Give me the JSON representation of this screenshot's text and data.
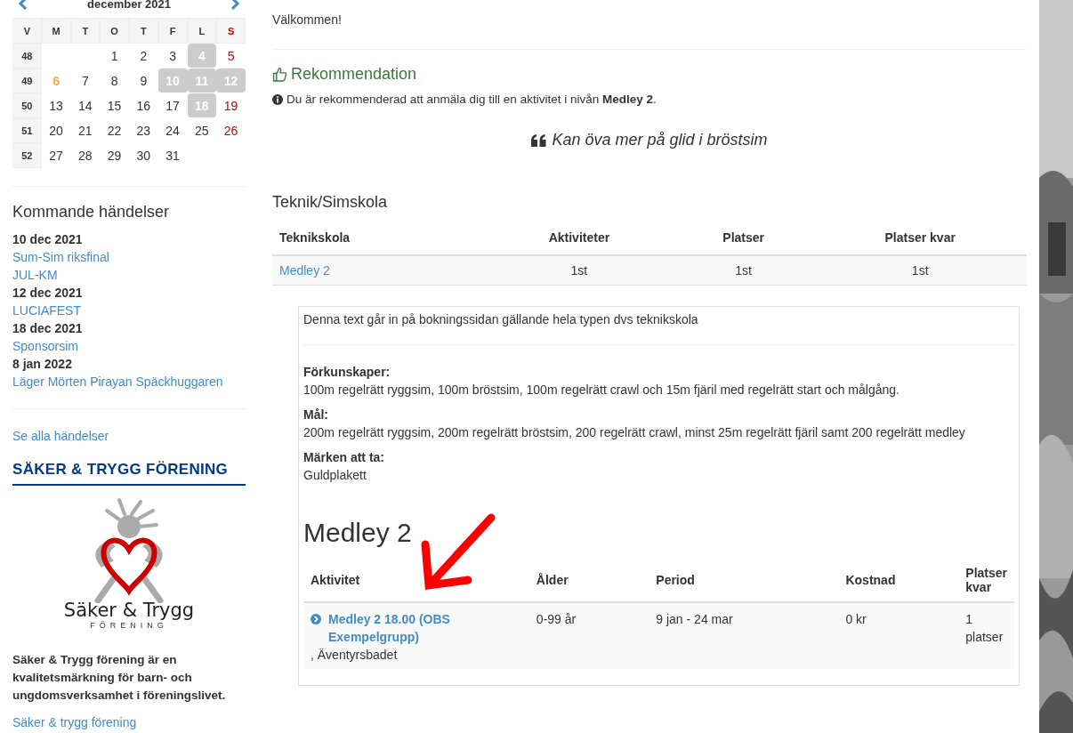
{
  "calendar": {
    "month": "december 2021",
    "headers": [
      {
        "label": "V",
        "kind": "week"
      },
      {
        "label": "M",
        "kind": "day"
      },
      {
        "label": "T",
        "kind": "day"
      },
      {
        "label": "O",
        "kind": "day"
      },
      {
        "label": "T",
        "kind": "day"
      },
      {
        "label": "F",
        "kind": "day"
      },
      {
        "label": "L",
        "kind": "day"
      },
      {
        "label": "S",
        "kind": "sunday"
      }
    ],
    "weeks": [
      {
        "week": "48",
        "days": [
          {
            "kind": "empty"
          },
          {
            "kind": "empty"
          },
          {
            "label": "1",
            "kind": "normal"
          },
          {
            "label": "2",
            "kind": "normal"
          },
          {
            "label": "3",
            "kind": "normal"
          },
          {
            "label": "4",
            "kind": "event"
          },
          {
            "label": "5",
            "kind": "sunday"
          }
        ]
      },
      {
        "week": "49",
        "days": [
          {
            "label": "6",
            "kind": "today"
          },
          {
            "label": "7",
            "kind": "normal"
          },
          {
            "label": "8",
            "kind": "normal"
          },
          {
            "label": "9",
            "kind": "normal"
          },
          {
            "label": "10",
            "kind": "event"
          },
          {
            "label": "11",
            "kind": "event"
          },
          {
            "label": "12",
            "kind": "event"
          }
        ]
      },
      {
        "week": "50",
        "days": [
          {
            "label": "13",
            "kind": "normal"
          },
          {
            "label": "14",
            "kind": "normal"
          },
          {
            "label": "15",
            "kind": "normal"
          },
          {
            "label": "16",
            "kind": "normal"
          },
          {
            "label": "17",
            "kind": "normal"
          },
          {
            "label": "18",
            "kind": "event"
          },
          {
            "label": "19",
            "kind": "sunday"
          }
        ]
      },
      {
        "week": "51",
        "days": [
          {
            "label": "20",
            "kind": "normal"
          },
          {
            "label": "21",
            "kind": "normal"
          },
          {
            "label": "22",
            "kind": "normal"
          },
          {
            "label": "23",
            "kind": "normal"
          },
          {
            "label": "24",
            "kind": "normal"
          },
          {
            "label": "25",
            "kind": "normal"
          },
          {
            "label": "26",
            "kind": "sunday"
          }
        ]
      },
      {
        "week": "52",
        "days": [
          {
            "label": "27",
            "kind": "normal"
          },
          {
            "label": "28",
            "kind": "normal"
          },
          {
            "label": "29",
            "kind": "normal"
          },
          {
            "label": "30",
            "kind": "normal"
          },
          {
            "label": "31",
            "kind": "normal"
          },
          {
            "kind": "empty"
          },
          {
            "kind": "empty"
          }
        ]
      }
    ]
  },
  "upcoming": {
    "title": "Kommande händelser",
    "items": [
      {
        "kind": "date",
        "text": "10 dec 2021"
      },
      {
        "kind": "link",
        "text": "Sum-Sim riksfinal"
      },
      {
        "kind": "link",
        "text": "JUL-KM"
      },
      {
        "kind": "date",
        "text": "12 dec 2021"
      },
      {
        "kind": "link",
        "text": "LUCIAFEST"
      },
      {
        "kind": "date",
        "text": "18 dec 2021"
      },
      {
        "kind": "link",
        "text": "Sponsorsim"
      },
      {
        "kind": "date",
        "text": "8 jan 2022"
      },
      {
        "kind": "link",
        "text": "Läger Mörten Pirayan Späckhuggaren"
      }
    ],
    "see_all": "Se alla händelser"
  },
  "safe_club": {
    "title": "SÄKER & TRYGG FÖRENING",
    "logo_name": "Säker & Trygg",
    "logo_sub": "FÖRENING",
    "text": "Säker & Trygg förening är en kvalitetsmärkning för barn- och ungdomsverksamhet i föreningslivet.",
    "link": "Säker & trygg förening"
  },
  "welcome": "Välkommen!",
  "recommendation": {
    "title": "Rekommendation",
    "text": "Du är rekommenderad att anmäla dig till en aktivitet i nivån **Medley 2**.",
    "quote": "Kan öva mer på glid i bröstsim"
  },
  "school": {
    "title": "Teknik/Simskola",
    "columns": [
      "Teknikskola",
      "Aktiviteter",
      "Platser",
      "Platser kvar"
    ],
    "rows": [
      {
        "name": "Medley 2",
        "activities": "1st",
        "places": "1st",
        "left": "1st"
      }
    ]
  },
  "details": {
    "intro": "Denna text går in på bokningssidan gällande hela typen dvs teknikskola",
    "sections": [
      {
        "label": "Förkunskaper:",
        "text": "100m regelrätt ryggsim, 100m bröstsim, 100m regelrätt crawl och 15m fjäril med regelrätt start och målgång."
      },
      {
        "label": "Mål:",
        "text": "200m regelrätt ryggsim, 200m regelrätt bröstsim, 200 regelrätt crawl, minst 25m regelrätt fjäril samt 200 regelrätt medley"
      },
      {
        "label": "Märken att ta:",
        "text": "Guldplakett"
      }
    ],
    "heading": "Medley 2",
    "columns": [
      "Aktivitet",
      "Ålder",
      "Period",
      "Kostnad",
      "Platser kvar"
    ],
    "rows": [
      {
        "name": "Medley 2 18.00 (OBS Exempelgrupp)",
        "place": ", Äventyrsbadet",
        "age": "0-99 år",
        "period": "9 jan - 24 mar",
        "cost": "0 kr",
        "left": "1 platser"
      }
    ]
  }
}
